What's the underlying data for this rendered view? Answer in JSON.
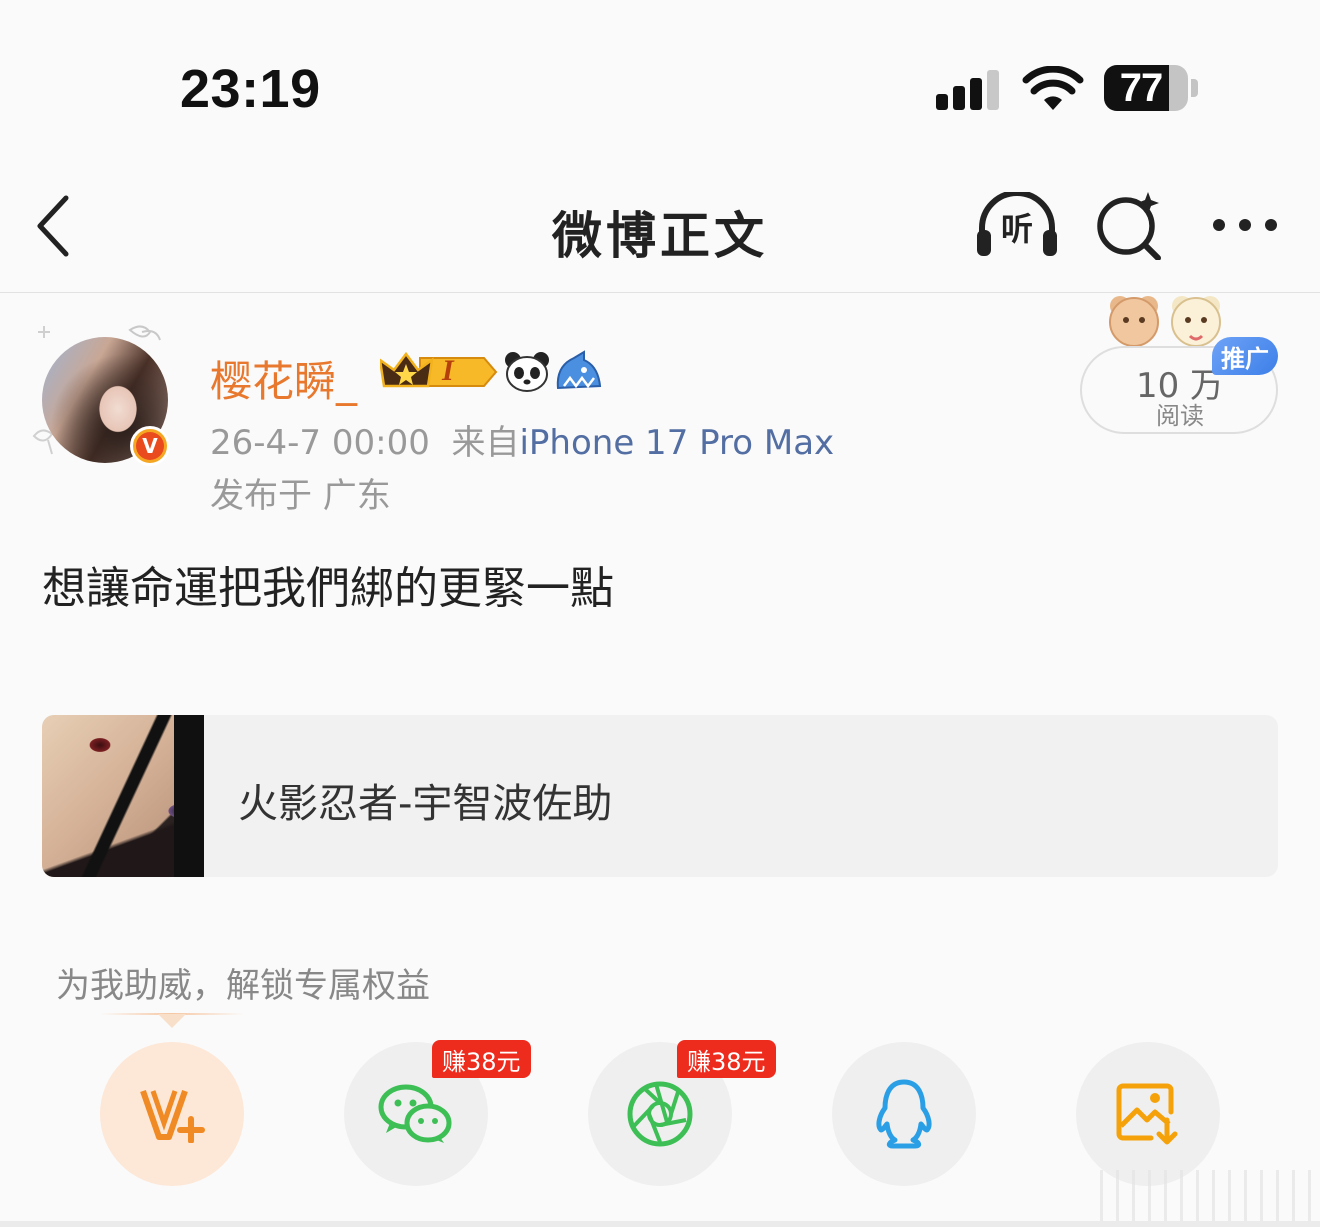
{
  "status_bar": {
    "time": "23:19",
    "battery_level": "77",
    "battery_fraction": 0.77
  },
  "nav": {
    "title": "微博正文",
    "listen_label": "听"
  },
  "post": {
    "username": "樱花瞬_",
    "verified_mark": "V",
    "member_level": "I",
    "timestamp": "26-4-7 00:00",
    "source_prefix": "来自",
    "device": "iPhone 17 Pro Max",
    "location": "发布于 广东",
    "read_count": "10 万",
    "read_label": "阅读",
    "promo_tag": "推广",
    "text": "想讓命運把我們綁的更緊一點",
    "link_card": {
      "title": "火影忍者-宇智波佐助"
    }
  },
  "share": {
    "hint": "为我助威，解锁专属权益",
    "buttons": [
      {
        "name": "vplus",
        "icon": "v-plus-icon",
        "badge": ""
      },
      {
        "name": "wechat",
        "icon": "wechat-icon",
        "badge": "赚38元"
      },
      {
        "name": "moments",
        "icon": "moments-icon",
        "badge": "赚38元"
      },
      {
        "name": "qq",
        "icon": "qq-icon",
        "badge": ""
      },
      {
        "name": "save-image",
        "icon": "save-image-icon",
        "badge": ""
      }
    ]
  },
  "colors": {
    "username": "#e8782d",
    "device_link": "#536ea2",
    "earn_tag": "#ee2c1e",
    "promo_tag": "#3d7fe8",
    "wechat": "#3dbf56",
    "qq": "#2b9fe6",
    "save": "#f5a20a"
  }
}
